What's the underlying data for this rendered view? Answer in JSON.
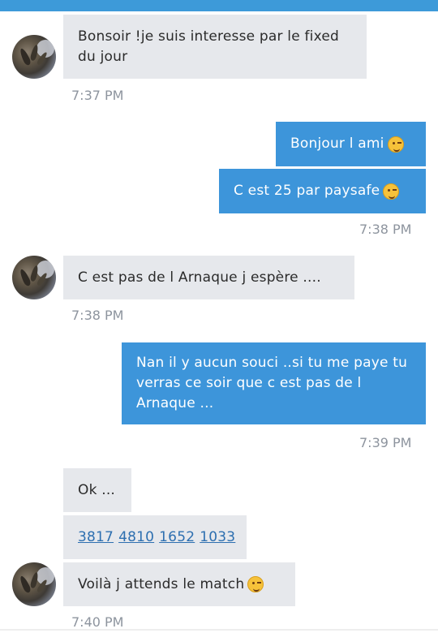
{
  "messages": [
    {
      "text": "Bonsoir !je suis interesse par le fixed du jour"
    },
    {
      "text": "Bonjour l ami"
    },
    {
      "text": "C est 25 par paysafe"
    },
    {
      "text": "C est  pas de l Arnaque j espère ...."
    },
    {
      "text": "Nan il  y aucun souci ..si tu me paye tu verras ce soir que c est pas de l Arnaque ..."
    },
    {
      "text": "Ok ..."
    },
    {
      "codes": [
        "3817",
        "4810",
        "1652",
        "1033"
      ]
    },
    {
      "text": "Voilà j attends le match"
    }
  ],
  "timestamps": [
    "7:37 PM",
    "7:38 PM",
    "7:38 PM",
    "7:39 PM",
    "7:40 PM"
  ],
  "icons": {
    "avatar": "contact-avatar",
    "emoji": "winking-face-emoji"
  },
  "colors": {
    "header": "#3d9ad9",
    "outgoing_bubble": "#3d95da",
    "incoming_bubble": "#e6e8ec",
    "timestamp": "#8d949e",
    "link": "#2d6fb0"
  }
}
